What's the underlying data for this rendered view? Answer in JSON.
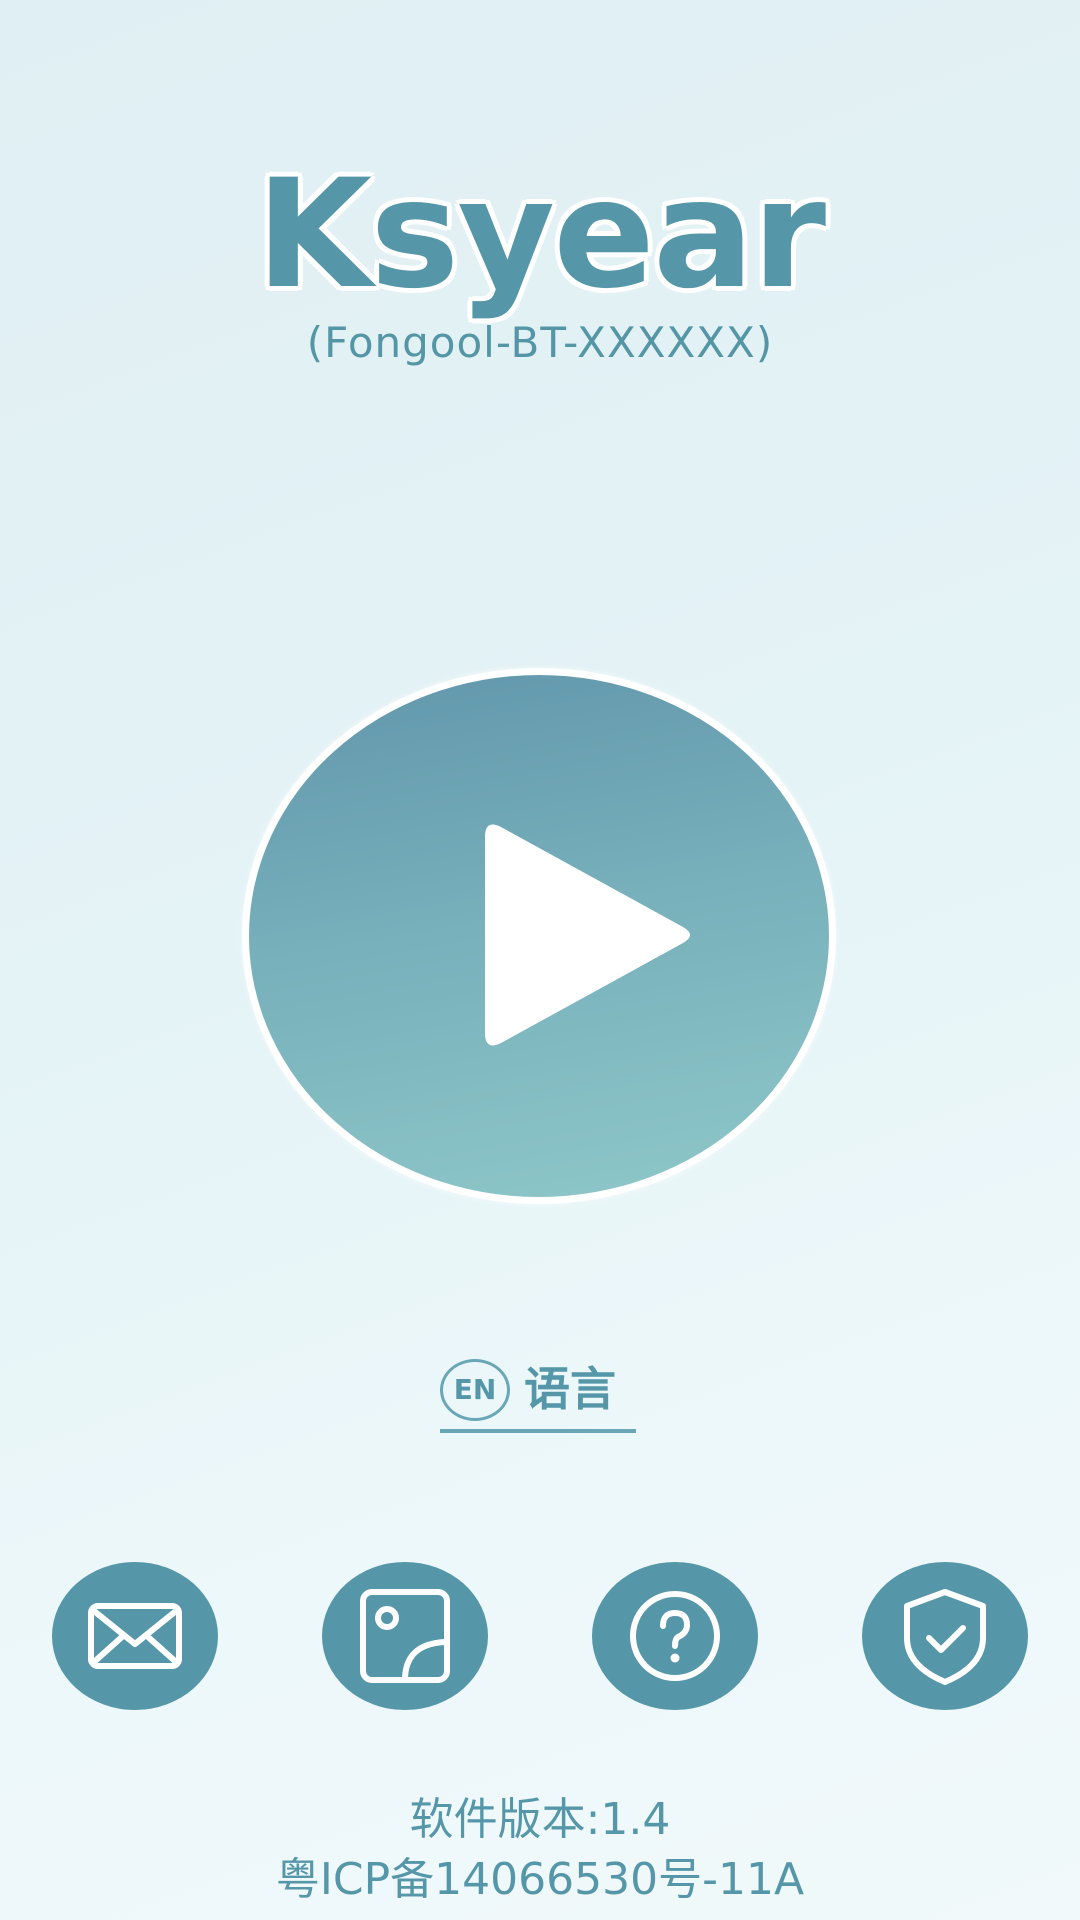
{
  "app": {
    "title": "Ksyear",
    "device_name": "(Fongool-BT-XXXXXX)"
  },
  "language": {
    "badge": "EN",
    "label": "语言"
  },
  "icons": [
    {
      "name": "mail-icon"
    },
    {
      "name": "gallery-icon"
    },
    {
      "name": "help-icon"
    },
    {
      "name": "shield-check-icon"
    }
  ],
  "footer": {
    "version": "软件版本:1.4",
    "icp": "粤ICP备14066530号-11A"
  },
  "colors": {
    "accent": "#5597a8",
    "play_top": "#6196ab",
    "play_bottom": "#8fc8c9",
    "background": "#e4f3f6"
  }
}
